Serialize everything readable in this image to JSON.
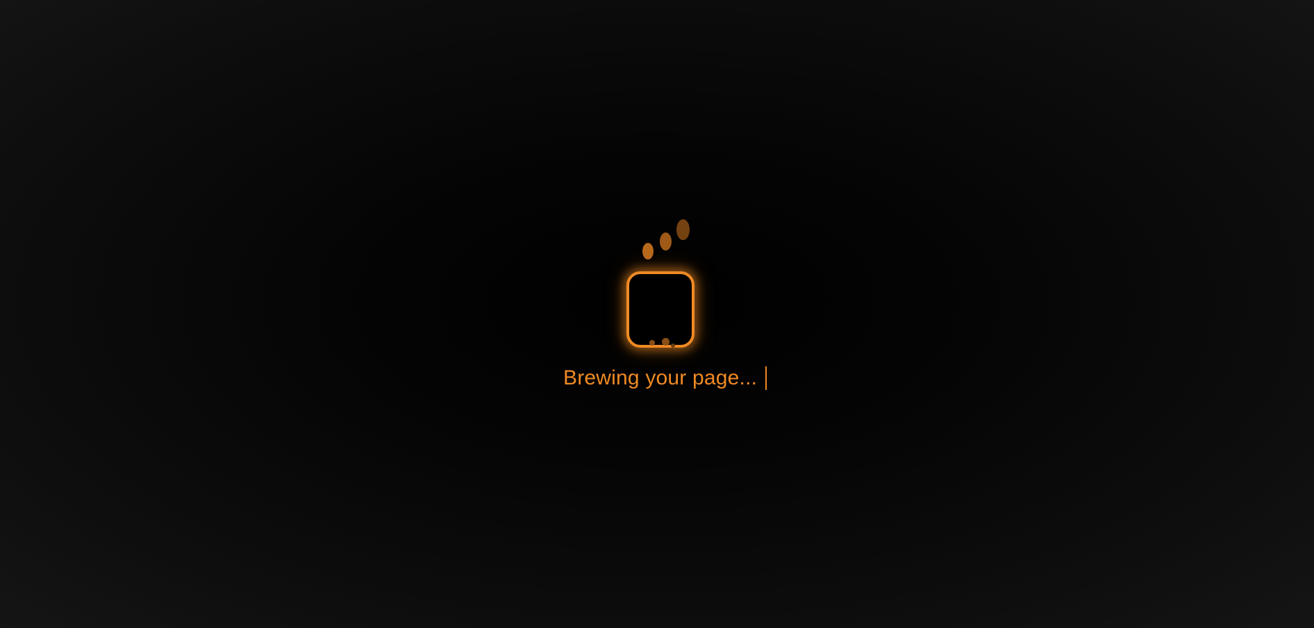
{
  "loader": {
    "icon": "coffee-cup-icon",
    "status_text": "Brewing your page...",
    "accent_color": "#f08a24",
    "background_color": "#000000"
  }
}
